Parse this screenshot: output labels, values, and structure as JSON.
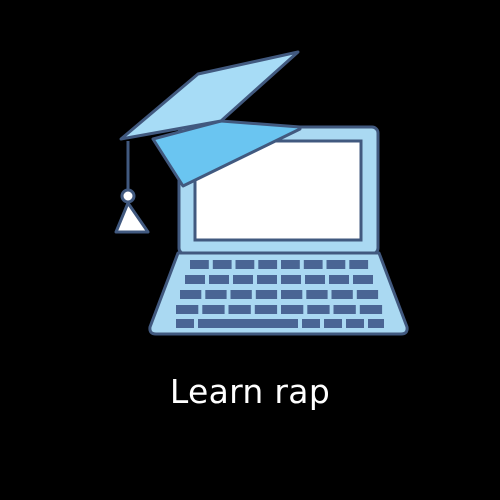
{
  "caption": {
    "text": "Learn rap"
  },
  "icon": {
    "name": "online-education-icon",
    "parts": [
      "laptop-icon",
      "graduation-cap-icon"
    ]
  },
  "colors": {
    "background": "#000000",
    "caption": "#ffffff",
    "outline": "#41597f",
    "laptop_body": "#aad9f2",
    "screen": "#ffffff",
    "keys": "#4a6594",
    "cap_top": "#a7dcf6",
    "cap_band": "#6ac5f1",
    "tassel": "#ffffff"
  }
}
